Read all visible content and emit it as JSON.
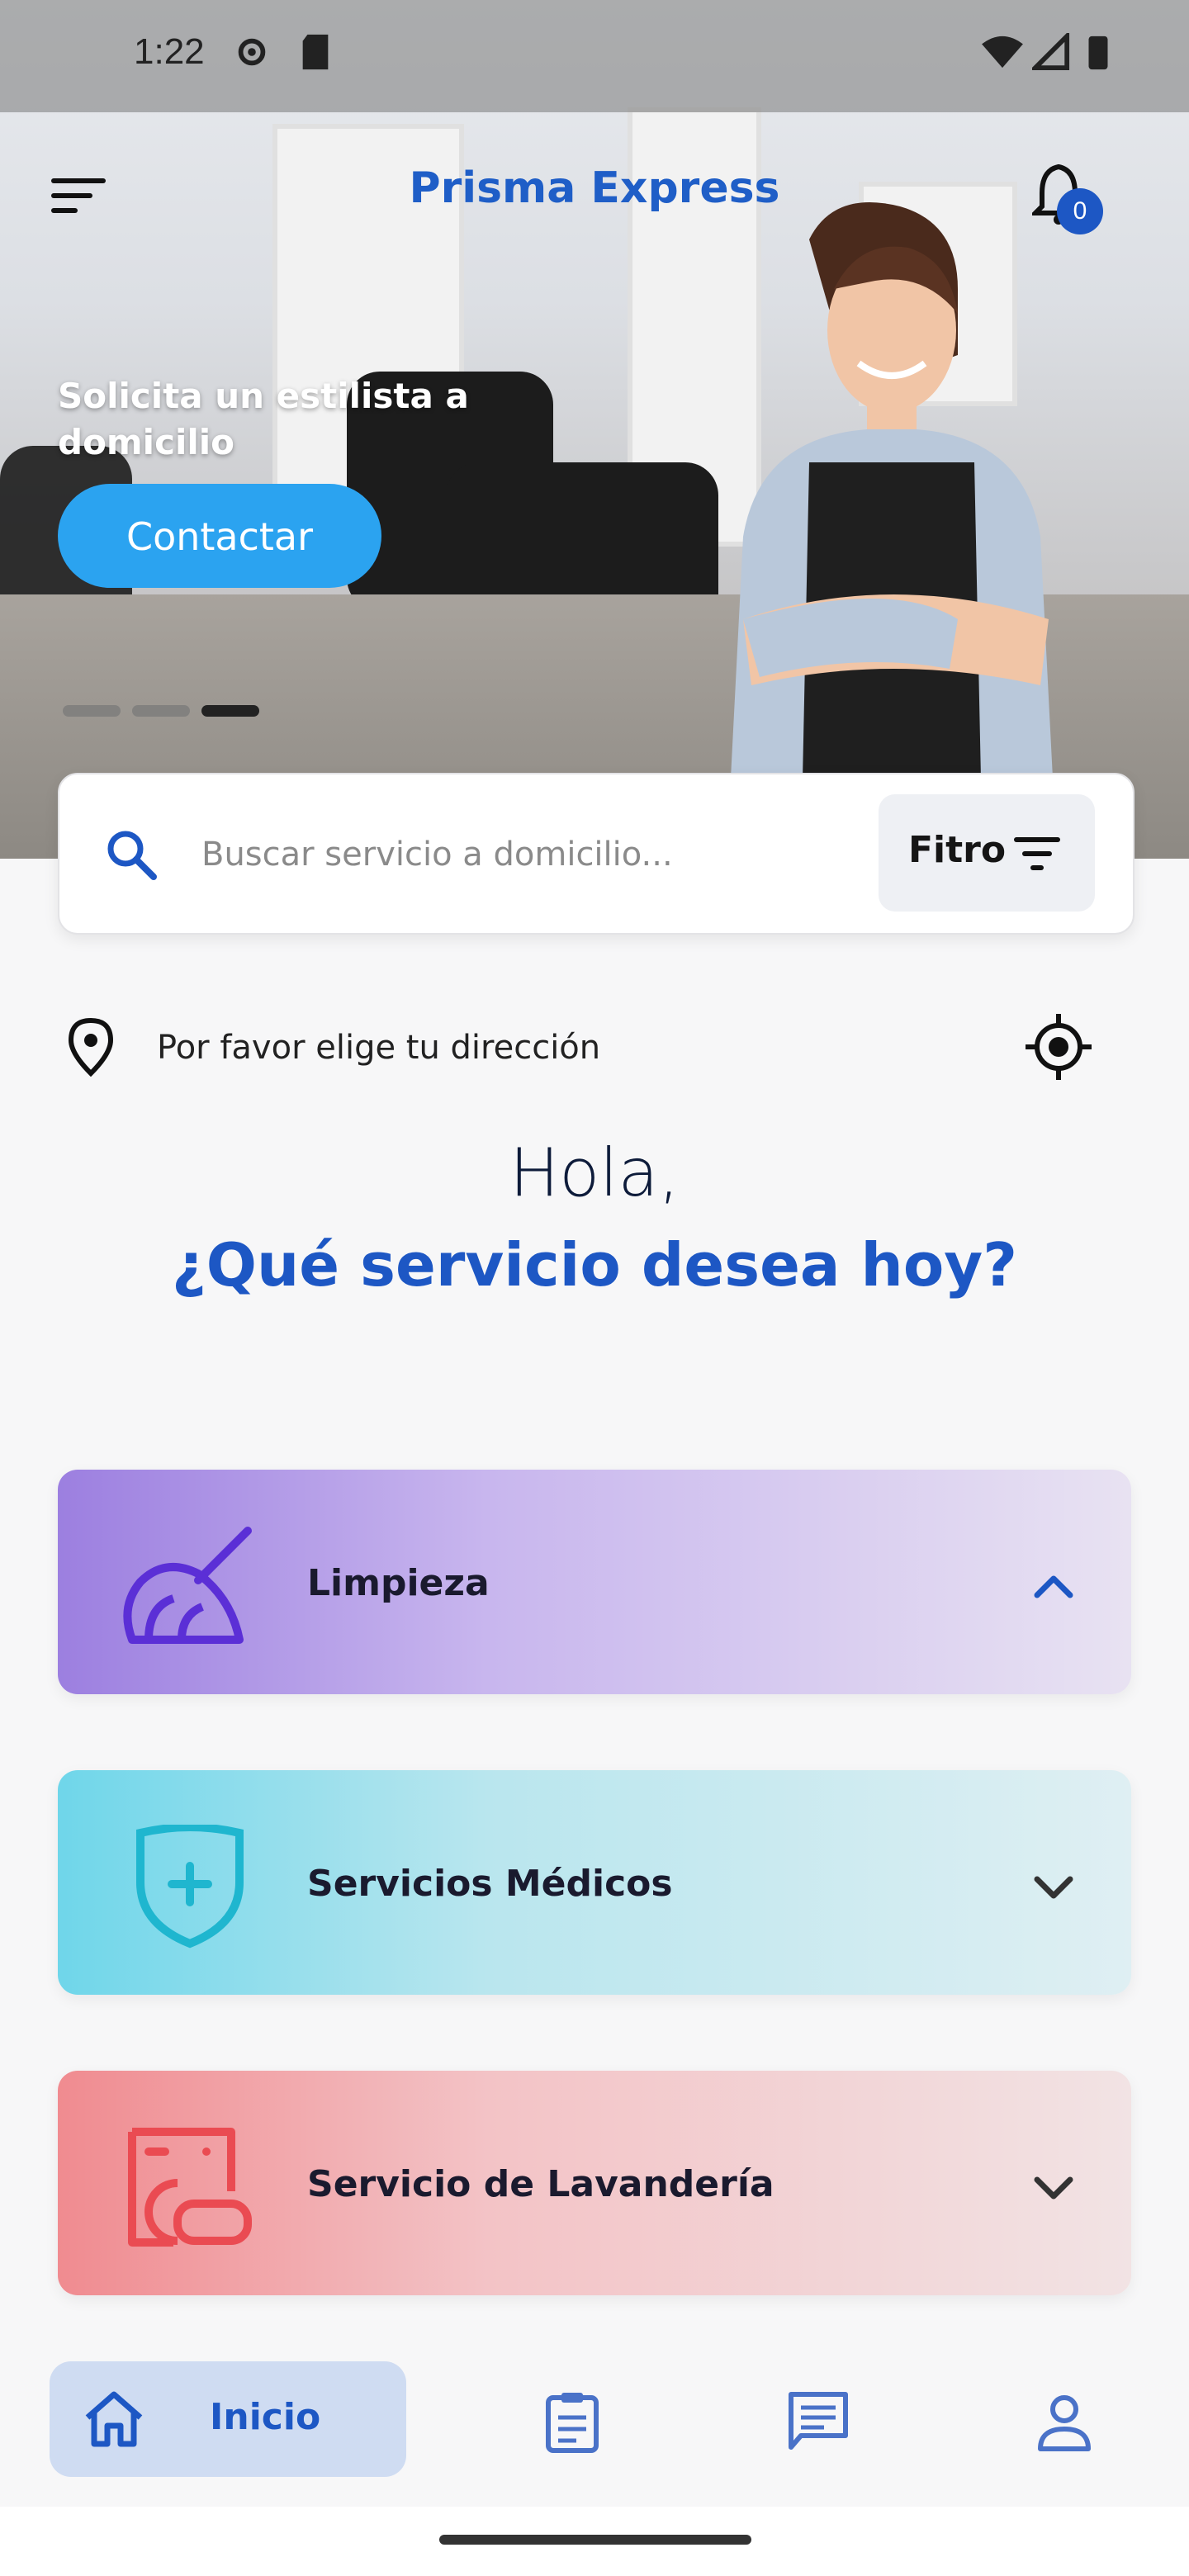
{
  "status_bar": {
    "time": "1:22"
  },
  "header": {
    "app_title": "Prisma Express",
    "notification_count": "0"
  },
  "banner": {
    "promo_text": "Solicita un estilista a domicilio",
    "cta_label": "Contactar",
    "slides_total": 3,
    "active_slide": 3
  },
  "search": {
    "placeholder": "Buscar servicio a domicilio...",
    "filter_label": "Fitro"
  },
  "address": {
    "text": "Por favor elige tu dirección"
  },
  "greeting": {
    "hello": "Hola,",
    "question": "¿Qué servicio desea hoy?"
  },
  "services": [
    {
      "label": "Limpieza",
      "icon": "broom-icon",
      "expanded": true,
      "color": "#5b2fd6"
    },
    {
      "label": "Servicios Médicos",
      "icon": "medical-shield-icon",
      "expanded": false,
      "color": "#1fb6cf"
    },
    {
      "label": "Servicio de Lavandería",
      "icon": "washing-machine-icon",
      "expanded": false,
      "color": "#ea4b52"
    }
  ],
  "bottom_nav": {
    "items": [
      {
        "label": "Inicio",
        "icon": "home-icon",
        "active": true
      },
      {
        "label": "",
        "icon": "clipboard-icon",
        "active": false
      },
      {
        "label": "",
        "icon": "chat-icon",
        "active": false
      },
      {
        "label": "",
        "icon": "profile-icon",
        "active": false
      }
    ]
  },
  "colors": {
    "brand": "#1d57c4",
    "accent": "#2ba3f0"
  }
}
